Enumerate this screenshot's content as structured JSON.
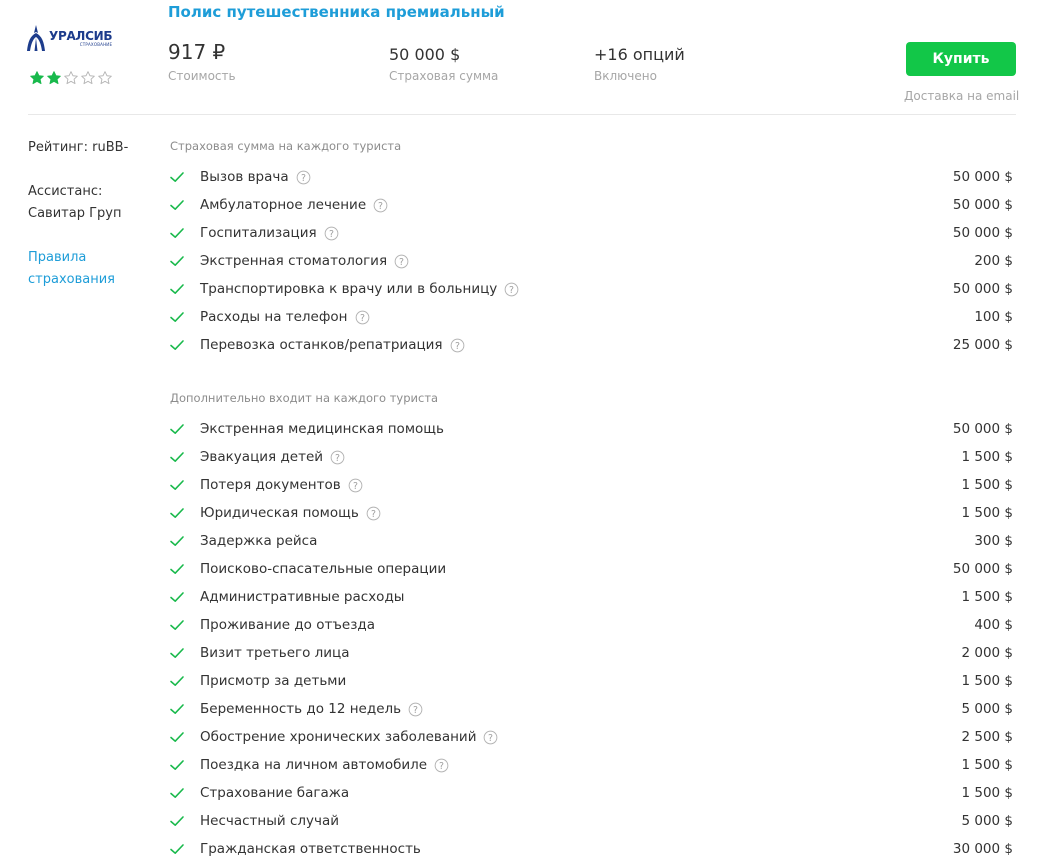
{
  "company": {
    "logo_name": "УРАЛСИБ",
    "logo_sub": "СТРАХОВАНИЕ",
    "rating_stars": 2,
    "max_stars": 5
  },
  "policy": {
    "title": "Полис путешественника премиальный",
    "price": "917 ₽",
    "price_label": "Стоимость",
    "sum": "50 000 $",
    "sum_label": "Страховая сумма",
    "options": "+16 опций",
    "options_label": "Включено",
    "buy_label": "Купить",
    "delivery": "Доставка на email"
  },
  "sidebar": {
    "rating": "Рейтинг: ruBB-",
    "assistance_line1": "Ассистанс:",
    "assistance_line2": "Савитар Груп",
    "rules_line1": "Правила",
    "rules_line2": "страхования"
  },
  "sections": [
    {
      "heading": "Страховая сумма на каждого туриста",
      "rows": [
        {
          "label": "Вызов врача",
          "value": "50 000 $",
          "help": true
        },
        {
          "label": "Амбулаторное лечение",
          "value": "50 000 $",
          "help": true
        },
        {
          "label": "Госпитализация",
          "value": "50 000 $",
          "help": true
        },
        {
          "label": "Экстренная стоматология",
          "value": "200 $",
          "help": true
        },
        {
          "label": "Транспортировка к врачу или в больницу",
          "value": "50 000 $",
          "help": true
        },
        {
          "label": "Расходы на телефон",
          "value": "100 $",
          "help": true
        },
        {
          "label": "Перевозка останков/репатриация",
          "value": "25 000 $",
          "help": true
        }
      ]
    },
    {
      "heading": "Дополнительно входит на каждого туриста",
      "rows": [
        {
          "label": "Экстренная медицинская помощь",
          "value": "50 000 $",
          "help": false
        },
        {
          "label": "Эвакуация детей",
          "value": "1 500 $",
          "help": true
        },
        {
          "label": "Потеря документов",
          "value": "1 500 $",
          "help": true
        },
        {
          "label": "Юридическая помощь",
          "value": "1 500 $",
          "help": true
        },
        {
          "label": "Задержка рейса",
          "value": "300 $",
          "help": false
        },
        {
          "label": "Поисково-спасательные операции",
          "value": "50 000 $",
          "help": false
        },
        {
          "label": "Административные расходы",
          "value": "1 500 $",
          "help": false
        },
        {
          "label": "Проживание до отъезда",
          "value": "400 $",
          "help": false
        },
        {
          "label": "Визит третьего лица",
          "value": "2 000 $",
          "help": false
        },
        {
          "label": "Присмотр за детьми",
          "value": "1 500 $",
          "help": false
        },
        {
          "label": "Беременность до 12 недель",
          "value": "5 000 $",
          "help": true
        },
        {
          "label": "Обострение хронических заболеваний",
          "value": "2 500 $",
          "help": true
        },
        {
          "label": "Поездка на личном автомобиле",
          "value": "1 500 $",
          "help": true
        },
        {
          "label": "Страхование багажа",
          "value": "1 500 $",
          "help": false
        },
        {
          "label": "Несчастный случай",
          "value": "5 000 $",
          "help": false
        },
        {
          "label": "Гражданская ответственность",
          "value": "30 000 $",
          "help": false
        }
      ]
    }
  ],
  "colors": {
    "brand_blue": "#1d3c8c",
    "link_blue": "#1e9dd8",
    "accent_green": "#12c748",
    "star_green": "#19b94c",
    "muted": "#a6a6a6"
  }
}
